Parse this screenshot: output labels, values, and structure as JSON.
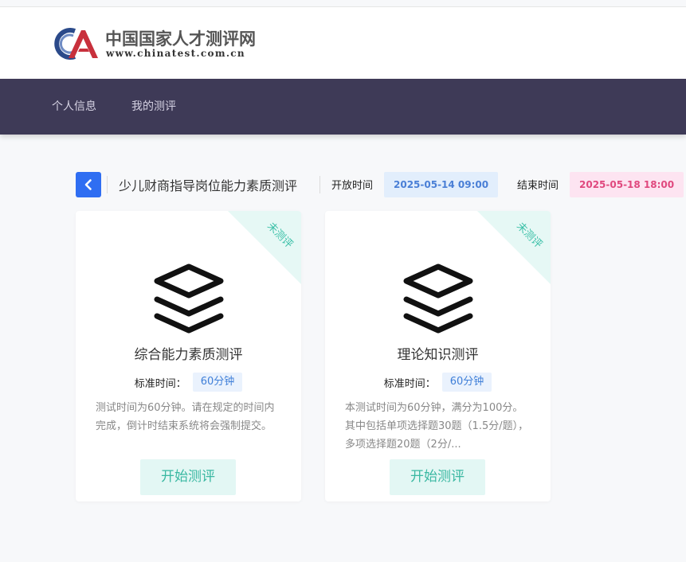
{
  "header": {
    "brand_cn": "中国国家人才测评网",
    "brand_url": "www.chinatest.com.cn"
  },
  "nav": {
    "items": [
      {
        "label": "个人信息"
      },
      {
        "label": "我的测评"
      }
    ]
  },
  "exam": {
    "title": "少儿财商指导岗位能力素质测评",
    "open_label": "开放时间",
    "open_time": "2025-05-14 09:00",
    "close_label": "结束时间",
    "close_time": "2025-05-18 18:00"
  },
  "cards": [
    {
      "status": "未测评",
      "title": "综合能力素质测评",
      "std_label": "标准时间：",
      "std_value": "60分钟",
      "desc": "测试时间为60分钟。请在规定的时间内完成，倒计时结束系统将会强制提交。",
      "button": "开始测评"
    },
    {
      "status": "未测评",
      "title": "理论知识测评",
      "std_label": "标准时间：",
      "std_value": "60分钟",
      "desc": "本测试时间为60分钟，满分为100分。其中包括单项选择题30题（1.5分/题），多项选择题20题（2分/...",
      "button": "开始测评"
    }
  ],
  "colors": {
    "nav_bg": "#3e3a57",
    "accent_blue": "#2f6ef2",
    "teal": "#3cc0a8",
    "pink": "#e0487e"
  },
  "icons": {
    "back": "chevron-left-icon",
    "card": "layers-icon",
    "logo": "chinatest-logo"
  }
}
